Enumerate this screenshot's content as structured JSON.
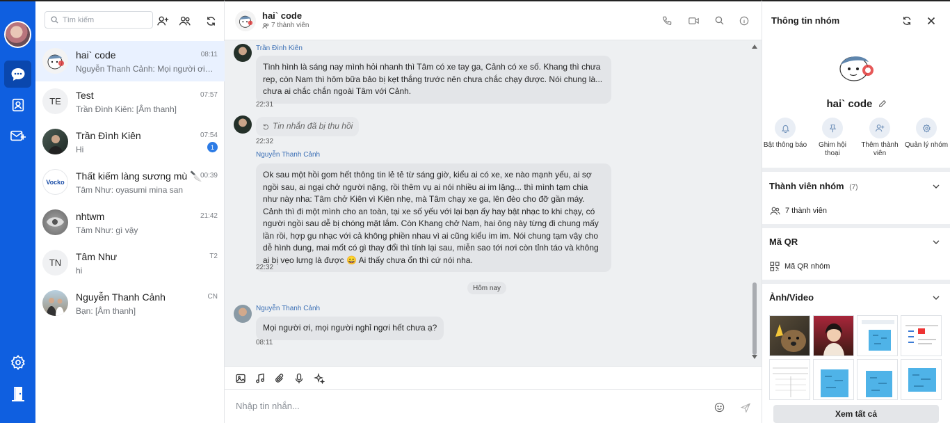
{
  "colors": {
    "rail": "#0f5fe0",
    "accent": "#2c7be5",
    "selected": "#e9f1ff"
  },
  "rail": {
    "items": [
      "chat-icon",
      "contacts-icon",
      "mail-icon"
    ],
    "bottom": [
      "settings-icon",
      "logout-icon"
    ]
  },
  "list": {
    "search_placeholder": "Tìm kiếm",
    "conversations": [
      {
        "name": "hai` code",
        "preview": "Nguyễn Thanh Cảnh: Mọi người ơi, ...",
        "time": "08:11",
        "selected": true
      },
      {
        "name": "Test",
        "initials": "TE",
        "preview": "Trần Đình Kiên: [Âm thanh]",
        "time": "07:57"
      },
      {
        "name": "Trần Đình Kiên",
        "preview": "Hi",
        "time": "07:54",
        "badge": "1"
      },
      {
        "name": "Thất kiếm làng sương mù 🔪",
        "preview": "Tâm Như: oyasumi mina san",
        "time": "00:39",
        "logo": "Vocko"
      },
      {
        "name": "nhtwm",
        "preview": "Tâm Như: gì vậy",
        "time": "21:42"
      },
      {
        "name": "Tâm Như",
        "initials": "TN",
        "preview": "hi",
        "time": "T2"
      },
      {
        "name": "Nguyễn Thanh Cảnh",
        "preview": "Bạn: [Âm thanh]",
        "time": "CN"
      }
    ]
  },
  "chat": {
    "title": "hai` code",
    "members": "7 thành viên",
    "messages": [
      {
        "sender": "Trần Đình Kiên",
        "text": "Tình hình là sáng nay mình hỏi nhanh thì Tâm có xe tay ga, Cảnh có xe số. Khang thì chưa rep, còn Nam thì hôm bữa bảo bị kẹt thắng trước nên chưa chắc chạy được. Nói chung là... chưa ai chắc chắn ngoài Tâm với Cảnh.",
        "time": "22:31"
      },
      {
        "recalled": "Tin nhắn đã bị thu hồi",
        "time": "22:32"
      },
      {
        "sender": "Nguyễn Thanh Cảnh",
        "text": "Ok sau một hồi gom hết thông tin lẻ tẻ từ sáng giờ, kiểu ai có xe, xe nào mạnh yếu, ai sợ ngồi sau, ai ngại chở người nặng, rồi thêm vụ ai nói nhiều ai im lặng... thì mình tạm chia như này nha: Tâm chở Kiên vì Kiên nhẹ, mà Tâm chạy xe ga, lên đèo cho đỡ gần máy. Cảnh thì đi một mình cho an toàn, tại xe số yếu với lại bạn ấy hay bật nhạc to khi chạy, có người ngồi sau dễ bị chóng mặt lắm. Còn Khang chở Nam, hai ông này từng đi chung mấy lần rồi, hợp gu nhạc với cả không phiền nhau vì ai cũng kiểu im im. Nói chung tạm vậy cho dễ hình dung, mai mốt có gì thay đổi thì tính lại sau, miễn sao tới nơi còn tỉnh táo và không ai bị vẹo lưng là được 😄 Ai thấy chưa ổn thì cứ nói nha.",
        "time": "22:32"
      },
      {
        "separator": "Hôm nay"
      },
      {
        "sender": "Nguyễn Thanh Cảnh",
        "text": "Mọi người ơi, mọi người nghỉ ngơi hết chưa ạ?",
        "time": "08:11"
      }
    ],
    "composer_placeholder": "Nhập tin nhắn..."
  },
  "info": {
    "title": "Thông tin nhóm",
    "group_name": "hai` code",
    "actions": [
      "Bật thông báo",
      "Ghim hội thoại",
      "Thêm thành viên",
      "Quản lý nhóm"
    ],
    "members_section": {
      "title": "Thành viên nhóm",
      "count": "(7)",
      "item": "7 thành viên"
    },
    "qr_section": {
      "title": "Mã QR",
      "item": "Mã QR nhóm"
    },
    "media_section": {
      "title": "Ảnh/Video",
      "view_all": "Xem tất cả"
    }
  }
}
